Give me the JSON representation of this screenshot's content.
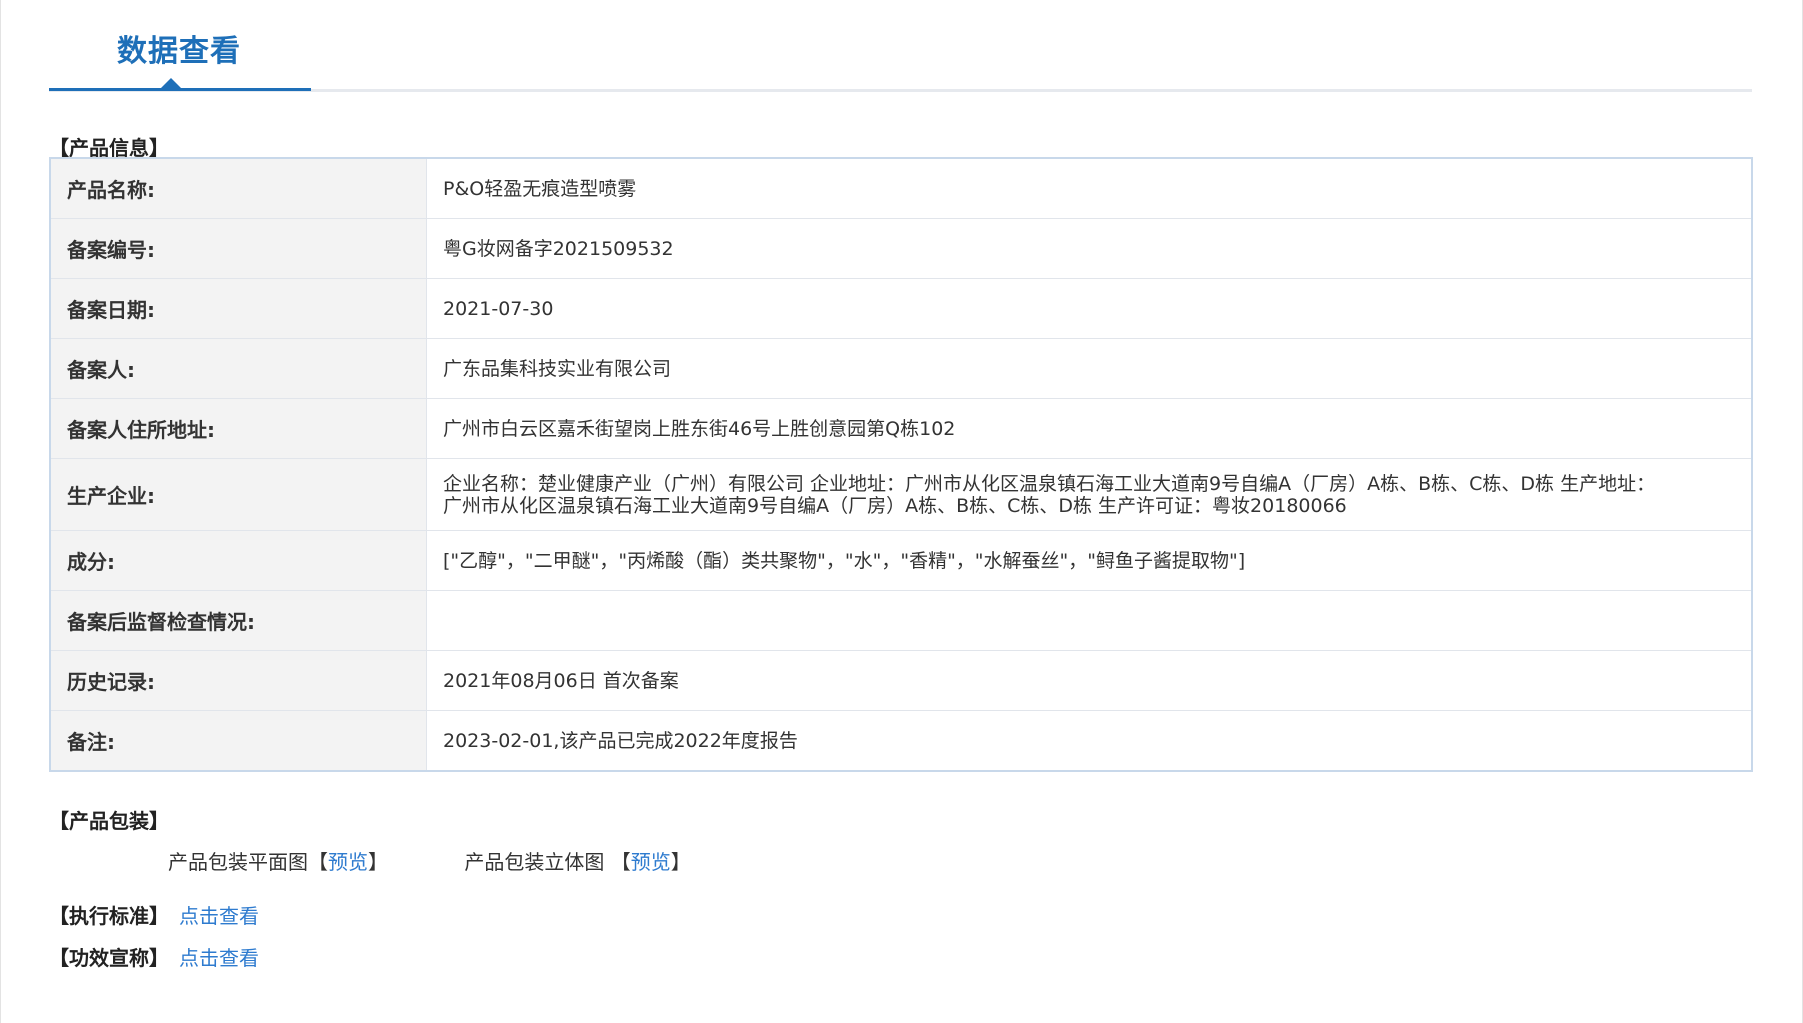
{
  "header": {
    "tab_title": "数据查看"
  },
  "sections": {
    "product_info_title": "【产品信息】",
    "packaging_title": "【产品包装】",
    "standard_label": "【执行标准】",
    "efficacy_label": "【功效宣称】"
  },
  "product_info": [
    {
      "label": "产品名称:",
      "value": "P&O轻盈无痕造型喷雾"
    },
    {
      "label": "备案编号:",
      "value": "粤G妆网备字2021509532"
    },
    {
      "label": "备案日期:",
      "value": "2021-07-30"
    },
    {
      "label": "备案人:",
      "value": "广东品集科技实业有限公司"
    },
    {
      "label": "备案人住所地址:",
      "value": "广州市白云区嘉禾街望岗上胜东街46号上胜创意园第Q栋102"
    },
    {
      "label": "生产企业:",
      "value": "企业名称：楚业健康产业（广州）有限公司 企业地址：广州市从化区温泉镇石海工业大道南9号自编A（厂房）A栋、B栋、C栋、D栋 生产地址：广州市从化区温泉镇石海工业大道南9号自编A（厂房）A栋、B栋、C栋、D栋 生产许可证：粤妆20180066"
    },
    {
      "label": "成分:",
      "value": "[\"乙醇\"，\"二甲醚\"，\"丙烯酸（酯）类共聚物\"，\"水\"，\"香精\"，\"水解蚕丝\"，\"鲟鱼子酱提取物\"]"
    },
    {
      "label": "备案后监督检查情况:",
      "value": ""
    },
    {
      "label": "历史记录:",
      "value": "2021年08月06日 首次备案"
    },
    {
      "label": "备注:",
      "value": "2023-02-01,该产品已完成2022年度报告"
    }
  ],
  "packaging": {
    "flat_label": "产品包装平面图【",
    "flat_link": "预览",
    "flat_close": "】",
    "solid_label": "产品包装立体图 【",
    "solid_link": "预览",
    "solid_close": "】"
  },
  "links": {
    "standard_link": "点击查看",
    "efficacy_link": "点击查看"
  },
  "colors": {
    "accent": "#1e6fb8",
    "link": "#2e7bcf",
    "label_bg": "#f3f3f3",
    "table_border": "#c8d8ea"
  }
}
